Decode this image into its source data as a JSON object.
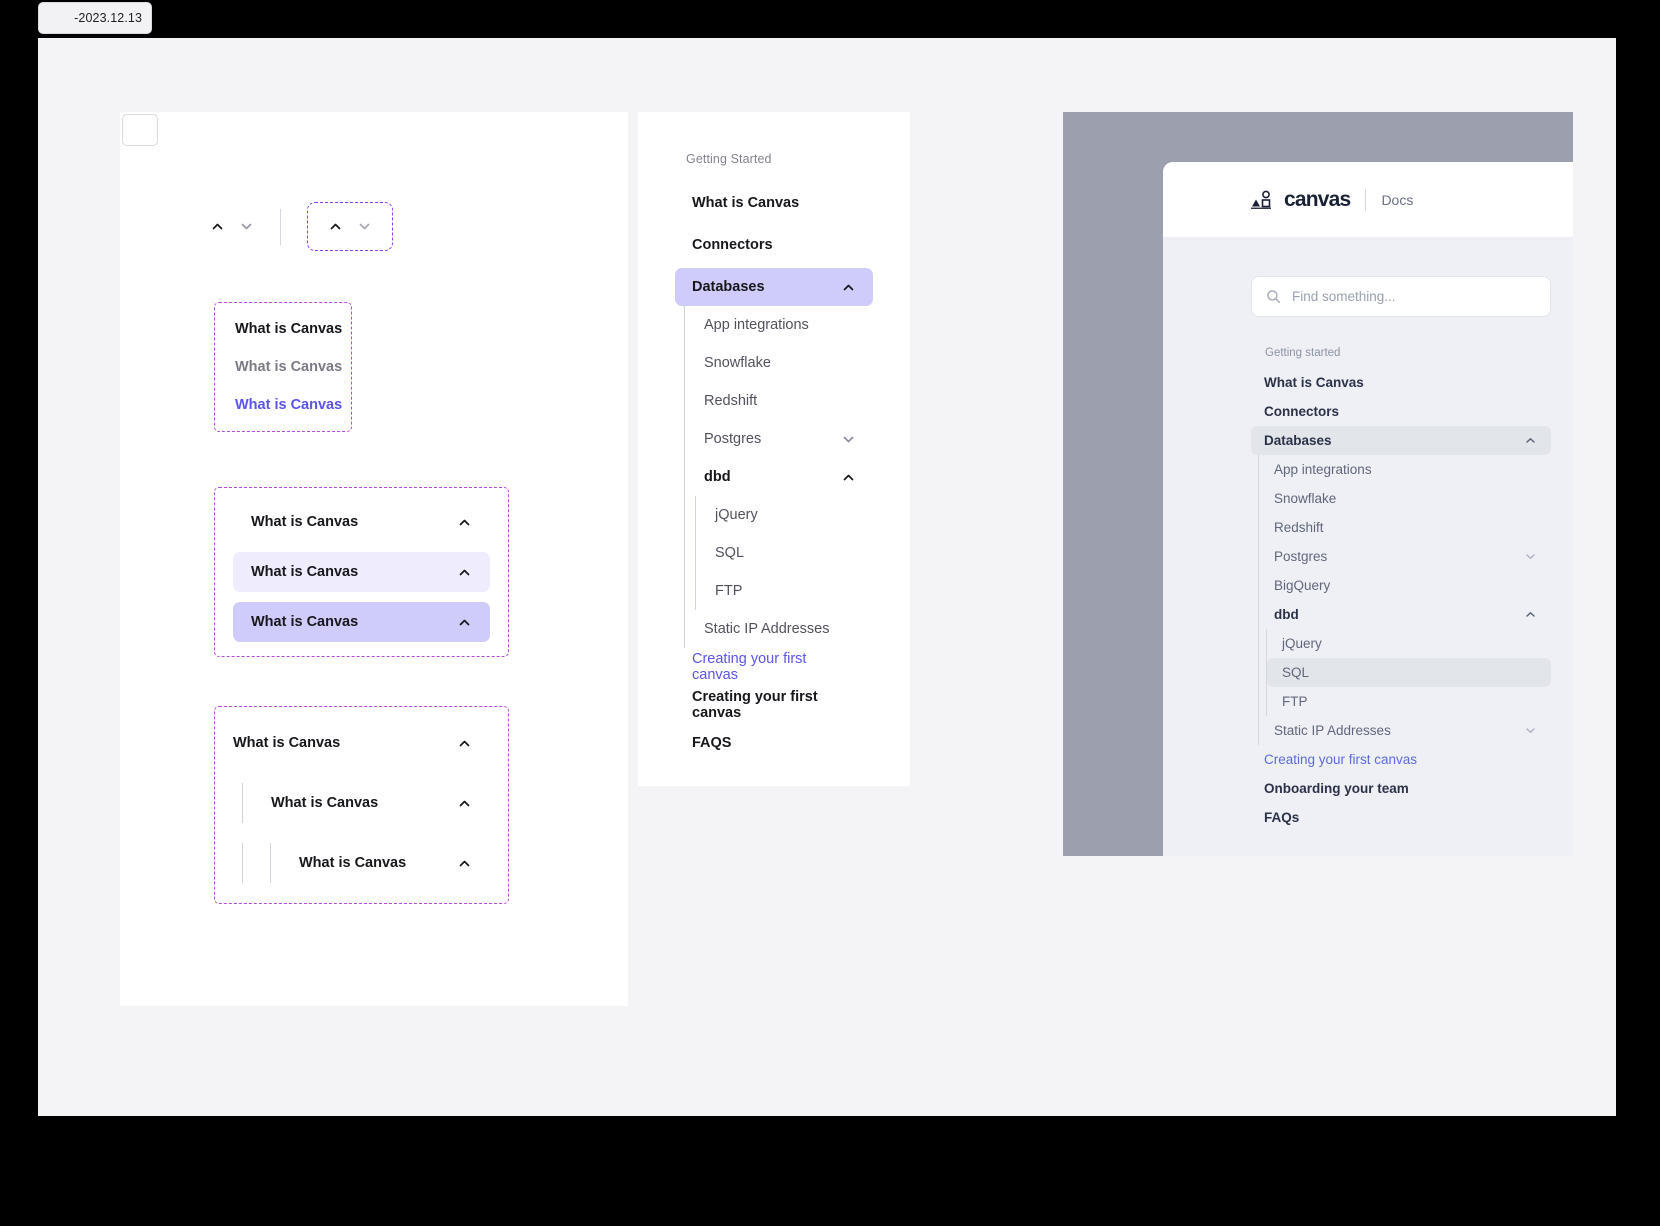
{
  "date_chip": {
    "label": "-2023.12.13"
  },
  "spec_panel": {
    "swatch_name": "color-swatch",
    "chevron_demo": {
      "up_icon": "chevron-up-icon",
      "down_icon": "chevron-down-icon",
      "boxed_up_icon": "chevron-up-icon",
      "boxed_down_icon": "chevron-down-icon"
    },
    "text_states": [
      {
        "label": "What is Canvas",
        "state": "default"
      },
      {
        "label": "What is Canvas",
        "state": "muted"
      },
      {
        "label": "What is Canvas",
        "state": "link"
      }
    ],
    "row_states": [
      {
        "label": "What is Canvas",
        "state": "rest"
      },
      {
        "label": "What is Canvas",
        "state": "hover"
      },
      {
        "label": "What is Canvas",
        "state": "active"
      }
    ],
    "nesting": [
      {
        "label": "What is Canvas",
        "level": 0
      },
      {
        "label": "What is Canvas",
        "level": 1
      },
      {
        "label": "What is Canvas",
        "level": 2
      }
    ]
  },
  "nav_panel": {
    "caption": "Getting Started",
    "items": [
      {
        "label": "What is Canvas"
      },
      {
        "label": "Connectors"
      },
      {
        "label": "Databases",
        "selected": true,
        "chevron": "chevron-up-icon"
      }
    ],
    "database_children": [
      {
        "label": "App integrations"
      },
      {
        "label": "Snowflake"
      },
      {
        "label": "Redshift"
      },
      {
        "label": "Postgres",
        "chevron": "chevron-down-icon"
      },
      {
        "label": "dbd",
        "bold": true,
        "chevron": "chevron-up-icon"
      }
    ],
    "dbd_children": [
      {
        "label": "jQuery"
      },
      {
        "label": "SQL",
        "selected": true
      },
      {
        "label": "FTP"
      }
    ],
    "after_children": [
      {
        "label": "Static IP Addresses"
      }
    ],
    "footer": [
      {
        "label": "Creating your first canvas",
        "style": "link"
      },
      {
        "label": "Creating your first canvas",
        "style": "plain"
      },
      {
        "label": "FAQS",
        "style": "plain"
      }
    ]
  },
  "mock": {
    "brand": {
      "mark": "canvas-logo-icon",
      "word": "canvas",
      "section": "Docs"
    },
    "search": {
      "icon": "search-icon",
      "placeholder": "Find something...",
      "value": ""
    },
    "caption": "Getting started",
    "items": [
      {
        "label": "What is Canvas"
      },
      {
        "label": "Connectors"
      },
      {
        "label": "Databases",
        "selected": true,
        "chevron": "chevron-up-icon"
      }
    ],
    "database_children": [
      {
        "label": "App integrations"
      },
      {
        "label": "Snowflake"
      },
      {
        "label": "Redshift"
      },
      {
        "label": "Postgres",
        "chevron": "chevron-down-icon"
      },
      {
        "label": "BigQuery"
      },
      {
        "label": "dbd",
        "bold": true,
        "chevron": "chevron-up-icon"
      }
    ],
    "dbd_children": [
      {
        "label": "jQuery"
      },
      {
        "label": "SQL",
        "selected": true
      },
      {
        "label": "FTP"
      }
    ],
    "after_children": [
      {
        "label": "Static IP Addresses",
        "chevron": "chevron-down-icon"
      }
    ],
    "footer": [
      {
        "label": "Creating your first canvas",
        "style": "link"
      },
      {
        "label": "Onboarding your team",
        "style": "plain"
      },
      {
        "label": "FAQs",
        "style": "plain"
      }
    ]
  },
  "colors": {
    "accent": "#5b54e8",
    "active_row": "#cfcbfa",
    "hover_row": "#eeecfd",
    "spec_dash_purple": "#b74ad8",
    "spec_dash_violet": "#8b3ff0",
    "mock_backdrop": "#9ca0ae",
    "mock_bg": "#eff0f5",
    "mock_sel": "#e2e5ea",
    "mock_link": "#5b6bdb"
  }
}
